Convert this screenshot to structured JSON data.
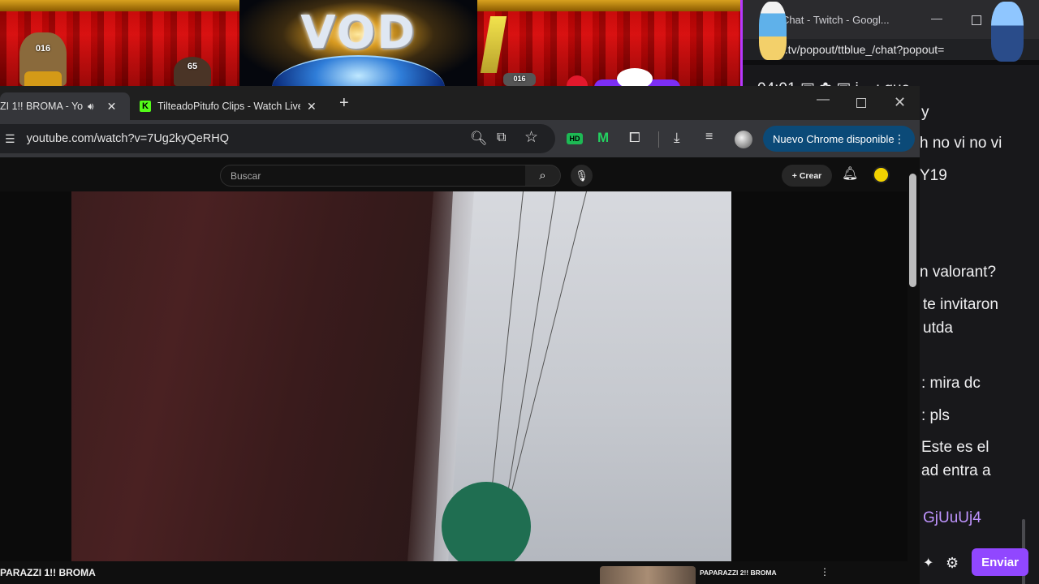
{
  "overlay": {
    "logo_text": "VOD",
    "sticker_cat_label": "016",
    "sticker_face_label": "65",
    "sticker_small_label": "016"
  },
  "chat_window": {
    "title": "- Chat - Twitch - Googl...",
    "url": "itch.tv/popout/ttblue_/chat?popout=",
    "lines": [
      {
        "text": "04:01 ▣ ✿ ▣ i ...: que"
      },
      {
        "text": "y"
      },
      {
        "text": "h no vi no vi"
      },
      {
        "text": "Y19"
      },
      {
        "text": "n valorant?"
      },
      {
        "text": "te invitaron"
      },
      {
        "text": "utda"
      },
      {
        "text": ": mira dc"
      },
      {
        "text": ": pls"
      },
      {
        "text": "Este es el"
      },
      {
        "text": "ad entra a"
      },
      {
        "text": "GjUuUj4"
      }
    ],
    "send_label": "Enviar"
  },
  "browser": {
    "tabs": [
      {
        "title": "ZI 1!! BROMA - Yo",
        "active": true
      },
      {
        "title": "TilteadoPitufo Clips - Watch Live",
        "favicon": "K",
        "active": false
      }
    ],
    "url": "youtube.com/watch?v=7Ug2kyQeRHQ",
    "update_label": "Nuevo Chrome disponible",
    "colors": {
      "update_pill": "#0b4a78",
      "kick_green": "#53fc18",
      "twitch_purple": "#9147ff"
    }
  },
  "youtube": {
    "search_placeholder": "Buscar",
    "create_label": "Crear",
    "video_title": "PARAZZI 1!! BROMA",
    "related_title": "PAPARAZZI 2!! BROMA"
  },
  "icons": {
    "audio": "speaker-icon",
    "close": "close-icon",
    "new_tab": "plus-icon",
    "zoom": "zoom-icon",
    "cast": "cast-icon",
    "bookmark": "star-icon",
    "extensions": "puzzle-icon",
    "download": "download-icon",
    "media": "media-queue-icon",
    "search": "search-icon",
    "mic": "mic-icon",
    "bell": "bell-icon",
    "settings": "gear-icon"
  }
}
